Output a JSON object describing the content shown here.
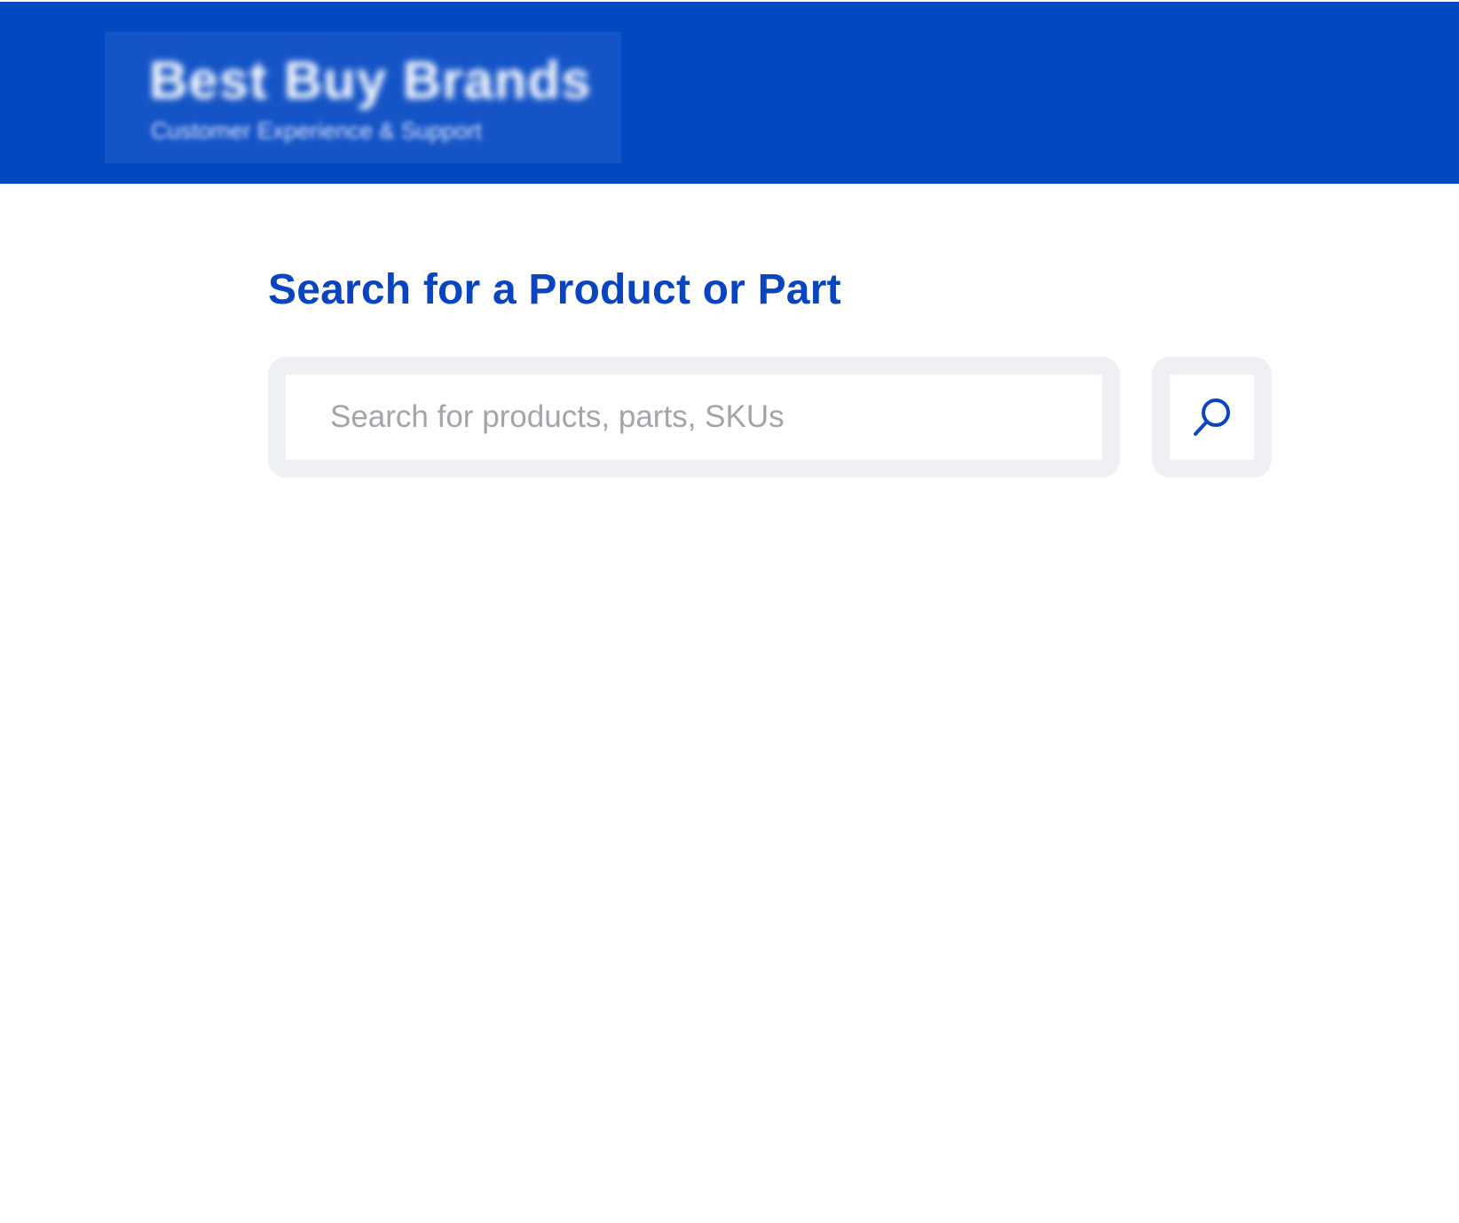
{
  "header": {
    "brand_title": "Best Buy Brands",
    "brand_subtitle": "Customer Experience & Support"
  },
  "main": {
    "page_title": "Search for a Product or Part",
    "search": {
      "value": "",
      "placeholder": "Search for products, parts, SKUs"
    },
    "search_button": {
      "icon": "search-icon",
      "aria_label": "Search"
    }
  },
  "colors": {
    "header_bg": "#0049c1",
    "brand_box_bg": "#1554c7",
    "title_blue": "#0a45c1",
    "search_frame": "#eff0f3",
    "placeholder_gray": "#a3a5a9",
    "icon_blue": "#0a45c1"
  }
}
